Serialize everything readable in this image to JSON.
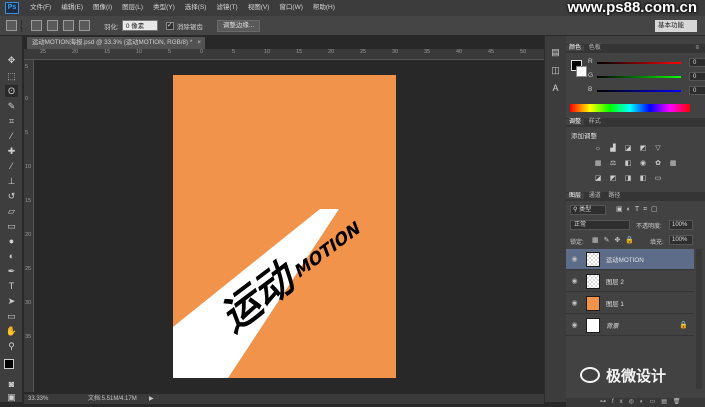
{
  "app": {
    "logo": "Ps"
  },
  "menu": [
    "文件(F)",
    "编辑(E)",
    "图像(I)",
    "图层(L)",
    "类型(Y)",
    "选择(S)",
    "滤镜(T)",
    "视图(V)",
    "窗口(W)",
    "帮助(H)"
  ],
  "watermark": "www.ps88.com.cn",
  "options": {
    "feather_label": "羽化:",
    "feather_value": "0 像素",
    "antialias_label": "消除锯齿",
    "refine_button": "调整边缘...",
    "workspace": "基本功能"
  },
  "document": {
    "tab_title": "运动MOTION海报.psd @ 33.3% (运动MOTION, RGB/8) *",
    "zoom": "33.33%",
    "doc_size": "文档:5.51M/4.17M",
    "ruler_marks": [
      "25",
      "20",
      "15",
      "10",
      "5",
      "0",
      "5",
      "10",
      "15",
      "20",
      "25",
      "30",
      "35",
      "40",
      "45",
      "50"
    ],
    "ruler_v_marks": [
      "5",
      "0",
      "5",
      "10",
      "15",
      "20",
      "25",
      "30",
      "35"
    ],
    "poster_text_cn": "运动",
    "poster_text_en": "MOTION"
  },
  "color_panel": {
    "tabs": [
      "颜色",
      "色板"
    ],
    "channels": [
      {
        "label": "R",
        "value": "0"
      },
      {
        "label": "G",
        "value": "0"
      },
      {
        "label": "B",
        "value": "0"
      }
    ]
  },
  "adjustments_panel": {
    "tabs": [
      "调整",
      "样式"
    ],
    "title": "添加调整"
  },
  "layers_panel": {
    "tabs": [
      "图层",
      "通道",
      "路径"
    ],
    "filter": "类型",
    "blend_mode": "正常",
    "opacity_label": "不透明度:",
    "opacity_value": "100%",
    "lock_label": "锁定:",
    "fill_label": "填充:",
    "fill_value": "100%",
    "layers": [
      {
        "name": "运动MOTION",
        "selected": true
      },
      {
        "name": "图层 2",
        "selected": false
      },
      {
        "name": "图层 1",
        "selected": false
      },
      {
        "name": "背景",
        "selected": false
      }
    ]
  },
  "credit": "极微设计",
  "colors": {
    "poster": "#f2934b",
    "selected_layer": "#5d6c89"
  }
}
